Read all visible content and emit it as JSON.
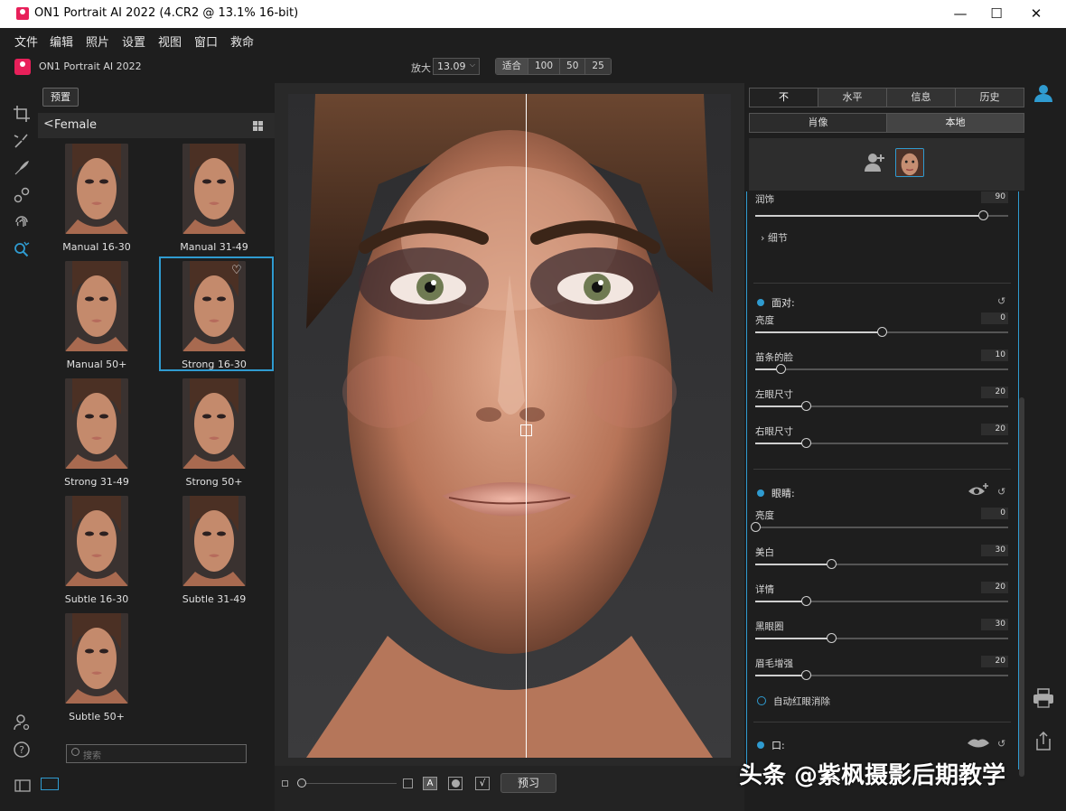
{
  "window": {
    "title": "ON1 Portrait AI 2022 (4.CR2 @ 13.1% 16-bit)",
    "minimize": "—",
    "maximize": "☐",
    "close": "✕"
  },
  "menu": [
    "文件",
    "编辑",
    "照片",
    "设置",
    "视图",
    "窗口",
    "救命"
  ],
  "app": {
    "brand": "ON1 Portrait AI 2022"
  },
  "zoom": {
    "label": "放大",
    "value": "13.09",
    "buttons": [
      "适合",
      "100",
      "50",
      "25"
    ]
  },
  "browser": {
    "preset_button": "预置",
    "category": "Female",
    "presets": [
      {
        "label": "Manual 16-30"
      },
      {
        "label": "Manual 31-49"
      },
      {
        "label": "Manual 50+"
      },
      {
        "label": "Strong 16-30",
        "selected": true,
        "favorite": true
      },
      {
        "label": "Strong 31-49"
      },
      {
        "label": "Strong 50+"
      },
      {
        "label": "Subtle 16-30"
      },
      {
        "label": "Subtle 31-49"
      },
      {
        "label": "Subtle 50+"
      }
    ],
    "search_placeholder": "搜索"
  },
  "bottom": {
    "preview": "预习",
    "mode_a": "A"
  },
  "right": {
    "tabs": [
      "不",
      "水平",
      "信息",
      "历史"
    ],
    "subtabs": [
      "肖像",
      "本地"
    ],
    "retouch": {
      "label": "润饰",
      "value": "90",
      "fraction": 0.9
    },
    "detail": "细节",
    "face": {
      "title": "面对:",
      "sliders": [
        {
          "label": "亮度",
          "value": "0",
          "fraction": 0.5
        },
        {
          "label": "苗条的脸",
          "value": "10",
          "fraction": 0.1
        },
        {
          "label": "左眼尺寸",
          "value": "20",
          "fraction": 0.2
        },
        {
          "label": "右眼尺寸",
          "value": "20",
          "fraction": 0.2
        }
      ]
    },
    "eyes": {
      "title": "眼睛:",
      "sliders": [
        {
          "label": "亮度",
          "value": "0",
          "fraction": 0.0
        },
        {
          "label": "美白",
          "value": "30",
          "fraction": 0.3
        },
        {
          "label": "详情",
          "value": "20",
          "fraction": 0.2
        },
        {
          "label": "黑眼圈",
          "value": "30",
          "fraction": 0.3
        },
        {
          "label": "眉毛增强",
          "value": "20",
          "fraction": 0.2
        }
      ],
      "redeye": "自动红眼消除"
    },
    "mouth": {
      "title": "口:"
    }
  },
  "watermark": "头条 @紫枫摄影后期教学",
  "colors": {
    "accent": "#2f9bd0",
    "brand": "#e8205a"
  }
}
